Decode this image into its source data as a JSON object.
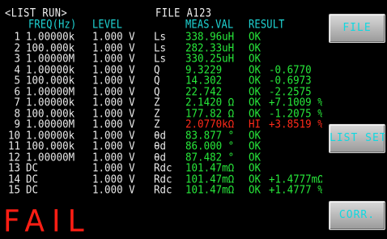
{
  "header": {
    "mode": "<LIST RUN>",
    "file": "FILE A123"
  },
  "columns": {
    "freq": "FREQ(Hz)",
    "level": "LEVEL",
    "meas": "MEAS.VAL",
    "result": "RESULT"
  },
  "rows": [
    {
      "num": "1",
      "freq": "1.00000k",
      "level": "1.000 V",
      "param": "Ls",
      "value": "338.96uH",
      "result": "OK",
      "dev": "",
      "status": "ok"
    },
    {
      "num": "2",
      "freq": "100.000k",
      "level": "1.000 V",
      "param": "Ls",
      "value": "282.33uH",
      "result": "OK",
      "dev": "",
      "status": "ok"
    },
    {
      "num": "3",
      "freq": "1.00000M",
      "level": "1.000 V",
      "param": "Ls",
      "value": "330.25uH",
      "result": "OK",
      "dev": "",
      "status": "ok"
    },
    {
      "num": "4",
      "freq": "1.00000k",
      "level": "1.000 V",
      "param": "Q",
      "value": "9.3229",
      "result": "OK",
      "dev": "-0.6770",
      "status": "ok"
    },
    {
      "num": "5",
      "freq": "100.000k",
      "level": "1.000 V",
      "param": "Q",
      "value": "14.302",
      "result": "OK",
      "dev": "-0.6973",
      "status": "ok"
    },
    {
      "num": "6",
      "freq": "1.00000M",
      "level": "1.000 V",
      "param": "Q",
      "value": "22.742",
      "result": "OK",
      "dev": "-2.2575",
      "status": "ok"
    },
    {
      "num": "7",
      "freq": "1.00000k",
      "level": "1.000 V",
      "param": "Z",
      "value": "2.1420 Ω",
      "result": "OK",
      "dev": "+7.1009 %",
      "status": "ok"
    },
    {
      "num": "8",
      "freq": "100.000k",
      "level": "1.000 V",
      "param": "Z",
      "value": "177.82 Ω",
      "result": "OK",
      "dev": "-1.2075 %",
      "status": "ok"
    },
    {
      "num": "9",
      "freq": "1.00000M",
      "level": "1.000 V",
      "param": "Z",
      "value": "2.0770kΩ",
      "result": "HI",
      "dev": "+3.8519 %",
      "status": "fail"
    },
    {
      "num": "10",
      "freq": "1.00000k",
      "level": "1.000 V",
      "param": "θd",
      "value": "83.877 °",
      "result": "OK",
      "dev": "",
      "status": "ok"
    },
    {
      "num": "11",
      "freq": "100.000k",
      "level": "1.000 V",
      "param": "θd",
      "value": "86.000 °",
      "result": "OK",
      "dev": "",
      "status": "ok"
    },
    {
      "num": "12",
      "freq": "1.00000M",
      "level": "1.000 V",
      "param": "θd",
      "value": "87.482 °",
      "result": "OK",
      "dev": "",
      "status": "ok"
    },
    {
      "num": "13",
      "freq": "DC",
      "level": "1.000 V",
      "param": "Rdc",
      "value": "101.47mΩ",
      "result": "OK",
      "dev": "",
      "status": "ok"
    },
    {
      "num": "14",
      "freq": "DC",
      "level": "1.000 V",
      "param": "Rdc",
      "value": "101.47mΩ",
      "result": "OK",
      "dev": "+1.4777mΩ",
      "status": "ok"
    },
    {
      "num": "15",
      "freq": "DC",
      "level": "1.000 V",
      "param": "Rdc",
      "value": "101.47mΩ",
      "result": "OK",
      "dev": "+1.4777 %",
      "status": "ok"
    }
  ],
  "verdict": "FAIL",
  "softkeys": {
    "file": "FILE",
    "list_set": "LIST SET",
    "corr": "CORR."
  },
  "colors": {
    "ok": "#27e83a",
    "fail": "#ff2a1a",
    "header_cyan": "#1fd6d6",
    "softkey_text": "#10d8e0"
  }
}
